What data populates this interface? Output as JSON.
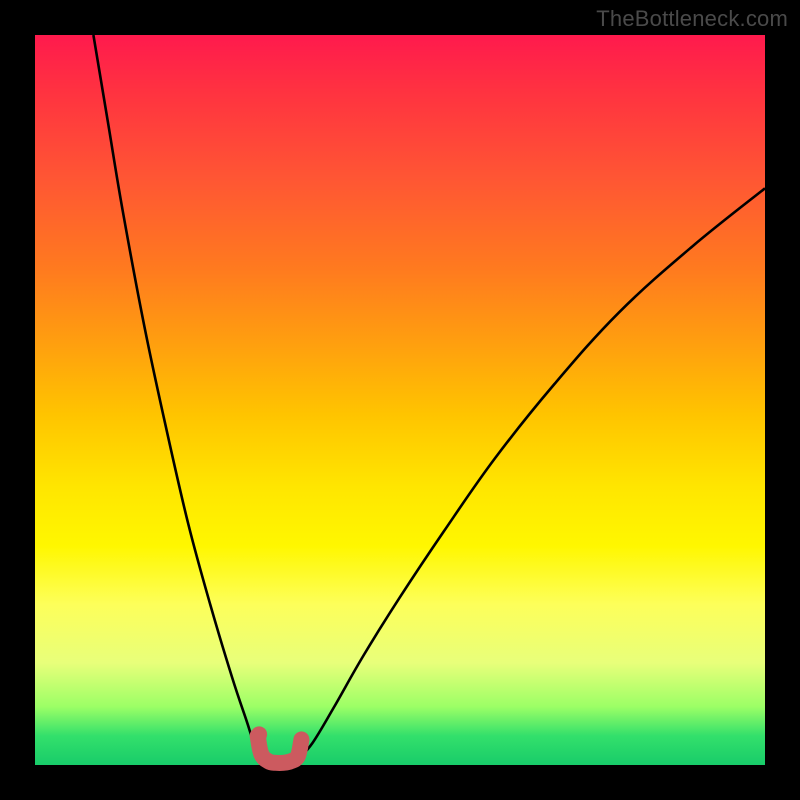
{
  "watermark": "TheBottleneck.com",
  "colors": {
    "frame": "#000000",
    "curve": "#000000",
    "accent": "#cc5a5f"
  },
  "chart_data": {
    "type": "line",
    "title": "",
    "xlabel": "",
    "ylabel": "",
    "xlim": [
      0,
      100
    ],
    "ylim": [
      0,
      100
    ],
    "grid": false,
    "legend": false,
    "description": "Two decreasing/increasing valley curves meeting near x≈33 with a flat minimum; background encodes a heat gradient from red (high bottleneck) to green (low bottleneck).",
    "series": [
      {
        "name": "left-branch",
        "x": [
          8,
          10,
          12,
          15,
          18,
          21,
          24,
          27,
          29,
          30,
          31,
          32
        ],
        "y": [
          100,
          88,
          76,
          60,
          46,
          33,
          22,
          12,
          6,
          3,
          1.5,
          0.8
        ]
      },
      {
        "name": "right-branch",
        "x": [
          36,
          38,
          41,
          45,
          50,
          56,
          63,
          71,
          80,
          90,
          100
        ],
        "y": [
          0.8,
          3,
          8,
          15,
          23,
          32,
          42,
          52,
          62,
          71,
          79
        ]
      },
      {
        "name": "valley-highlight",
        "x": [
          30.5,
          31,
          32,
          33,
          34,
          35,
          36,
          36.5
        ],
        "y": [
          4,
          1.5,
          0.5,
          0.3,
          0.3,
          0.5,
          1.2,
          3.5
        ]
      }
    ],
    "annotations": [
      {
        "type": "dot",
        "x": 30.7,
        "y": 4.2,
        "color": "#cc5a5f"
      }
    ]
  }
}
